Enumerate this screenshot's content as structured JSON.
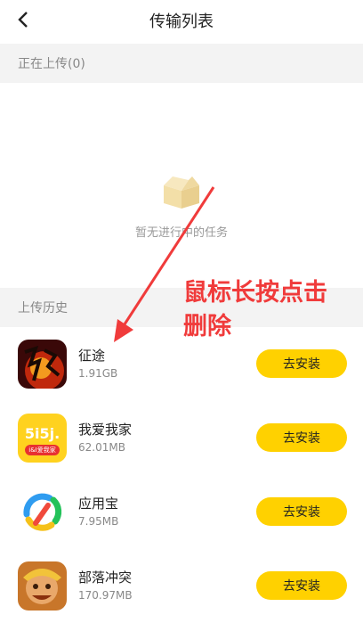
{
  "header": {
    "title": "传输列表"
  },
  "uploading": {
    "label": "正在上传(0)",
    "empty_text": "暂无进行中的任务"
  },
  "history": {
    "label": "上传历史"
  },
  "apps": [
    {
      "name": "征途",
      "size": "1.91GB",
      "install_label": "去安装"
    },
    {
      "name": "我爱我家",
      "size": "62.01MB",
      "install_label": "去安装",
      "icon_text": "5i5j.",
      "icon_subtext": "i&I爱我家"
    },
    {
      "name": "应用宝",
      "size": "7.95MB",
      "install_label": "去安装"
    },
    {
      "name": "部落冲突",
      "size": "170.97MB",
      "install_label": "去安装"
    }
  ],
  "annotation": {
    "line1": "鼠标长按点击",
    "line2": "删除"
  },
  "colors": {
    "accent": "#ffd100",
    "annotation": "#f03b3b",
    "section_bg": "#f3f3f3"
  }
}
